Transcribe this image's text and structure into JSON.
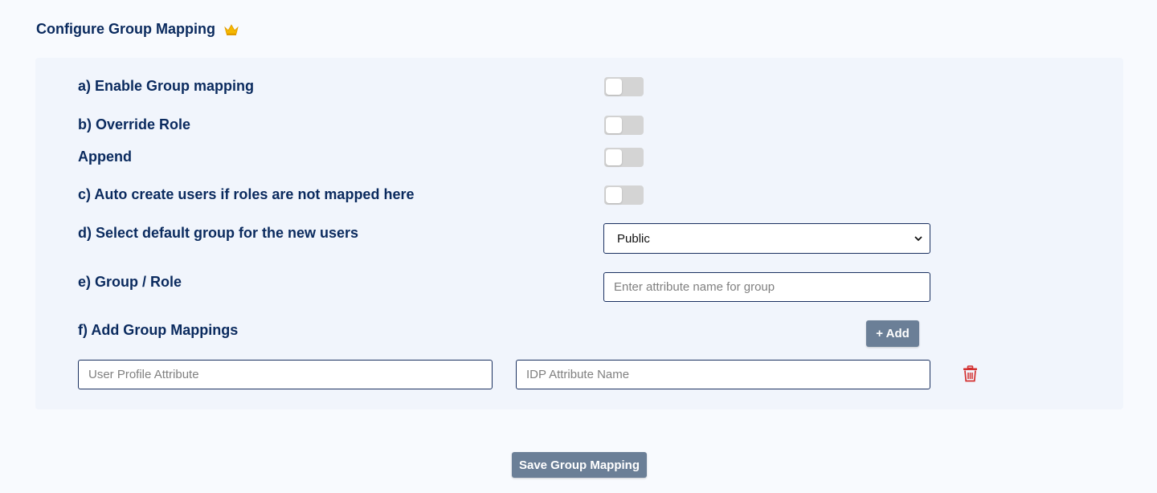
{
  "header": {
    "title": "Configure Group Mapping",
    "crown_icon": "crown-icon",
    "crown_color": "#f5b800"
  },
  "settings": {
    "enable_group_mapping": {
      "label": "a) Enable Group mapping",
      "enabled": false
    },
    "override_role": {
      "label": "b) Override Role",
      "enabled": false
    },
    "append": {
      "label": "Append",
      "enabled": false
    },
    "auto_create_users": {
      "label": "c) Auto create users if roles are not mapped here",
      "enabled": false
    },
    "default_group": {
      "label": "d) Select default group for the new users",
      "selected": "Public"
    },
    "group_role": {
      "label": "e) Group / Role",
      "value": "",
      "placeholder": "Enter attribute name for group"
    },
    "group_mappings": {
      "label": "f) Add Group Mappings",
      "add_label": "+ Add",
      "rows": [
        {
          "user_profile_attribute": {
            "value": "",
            "placeholder": "User Profile Attribute"
          },
          "idp_attribute_name": {
            "value": "",
            "placeholder": "IDP Attribute Name"
          },
          "delete_icon": "trash-icon"
        }
      ]
    }
  },
  "footer": {
    "save_label": "Save Group Mapping"
  },
  "colors": {
    "heading": "#0a2a5e",
    "button": "#6b7f97",
    "toggle_off": "#d4d4d4",
    "delete": "#d32f2f",
    "panel": "#f1f5fc"
  }
}
